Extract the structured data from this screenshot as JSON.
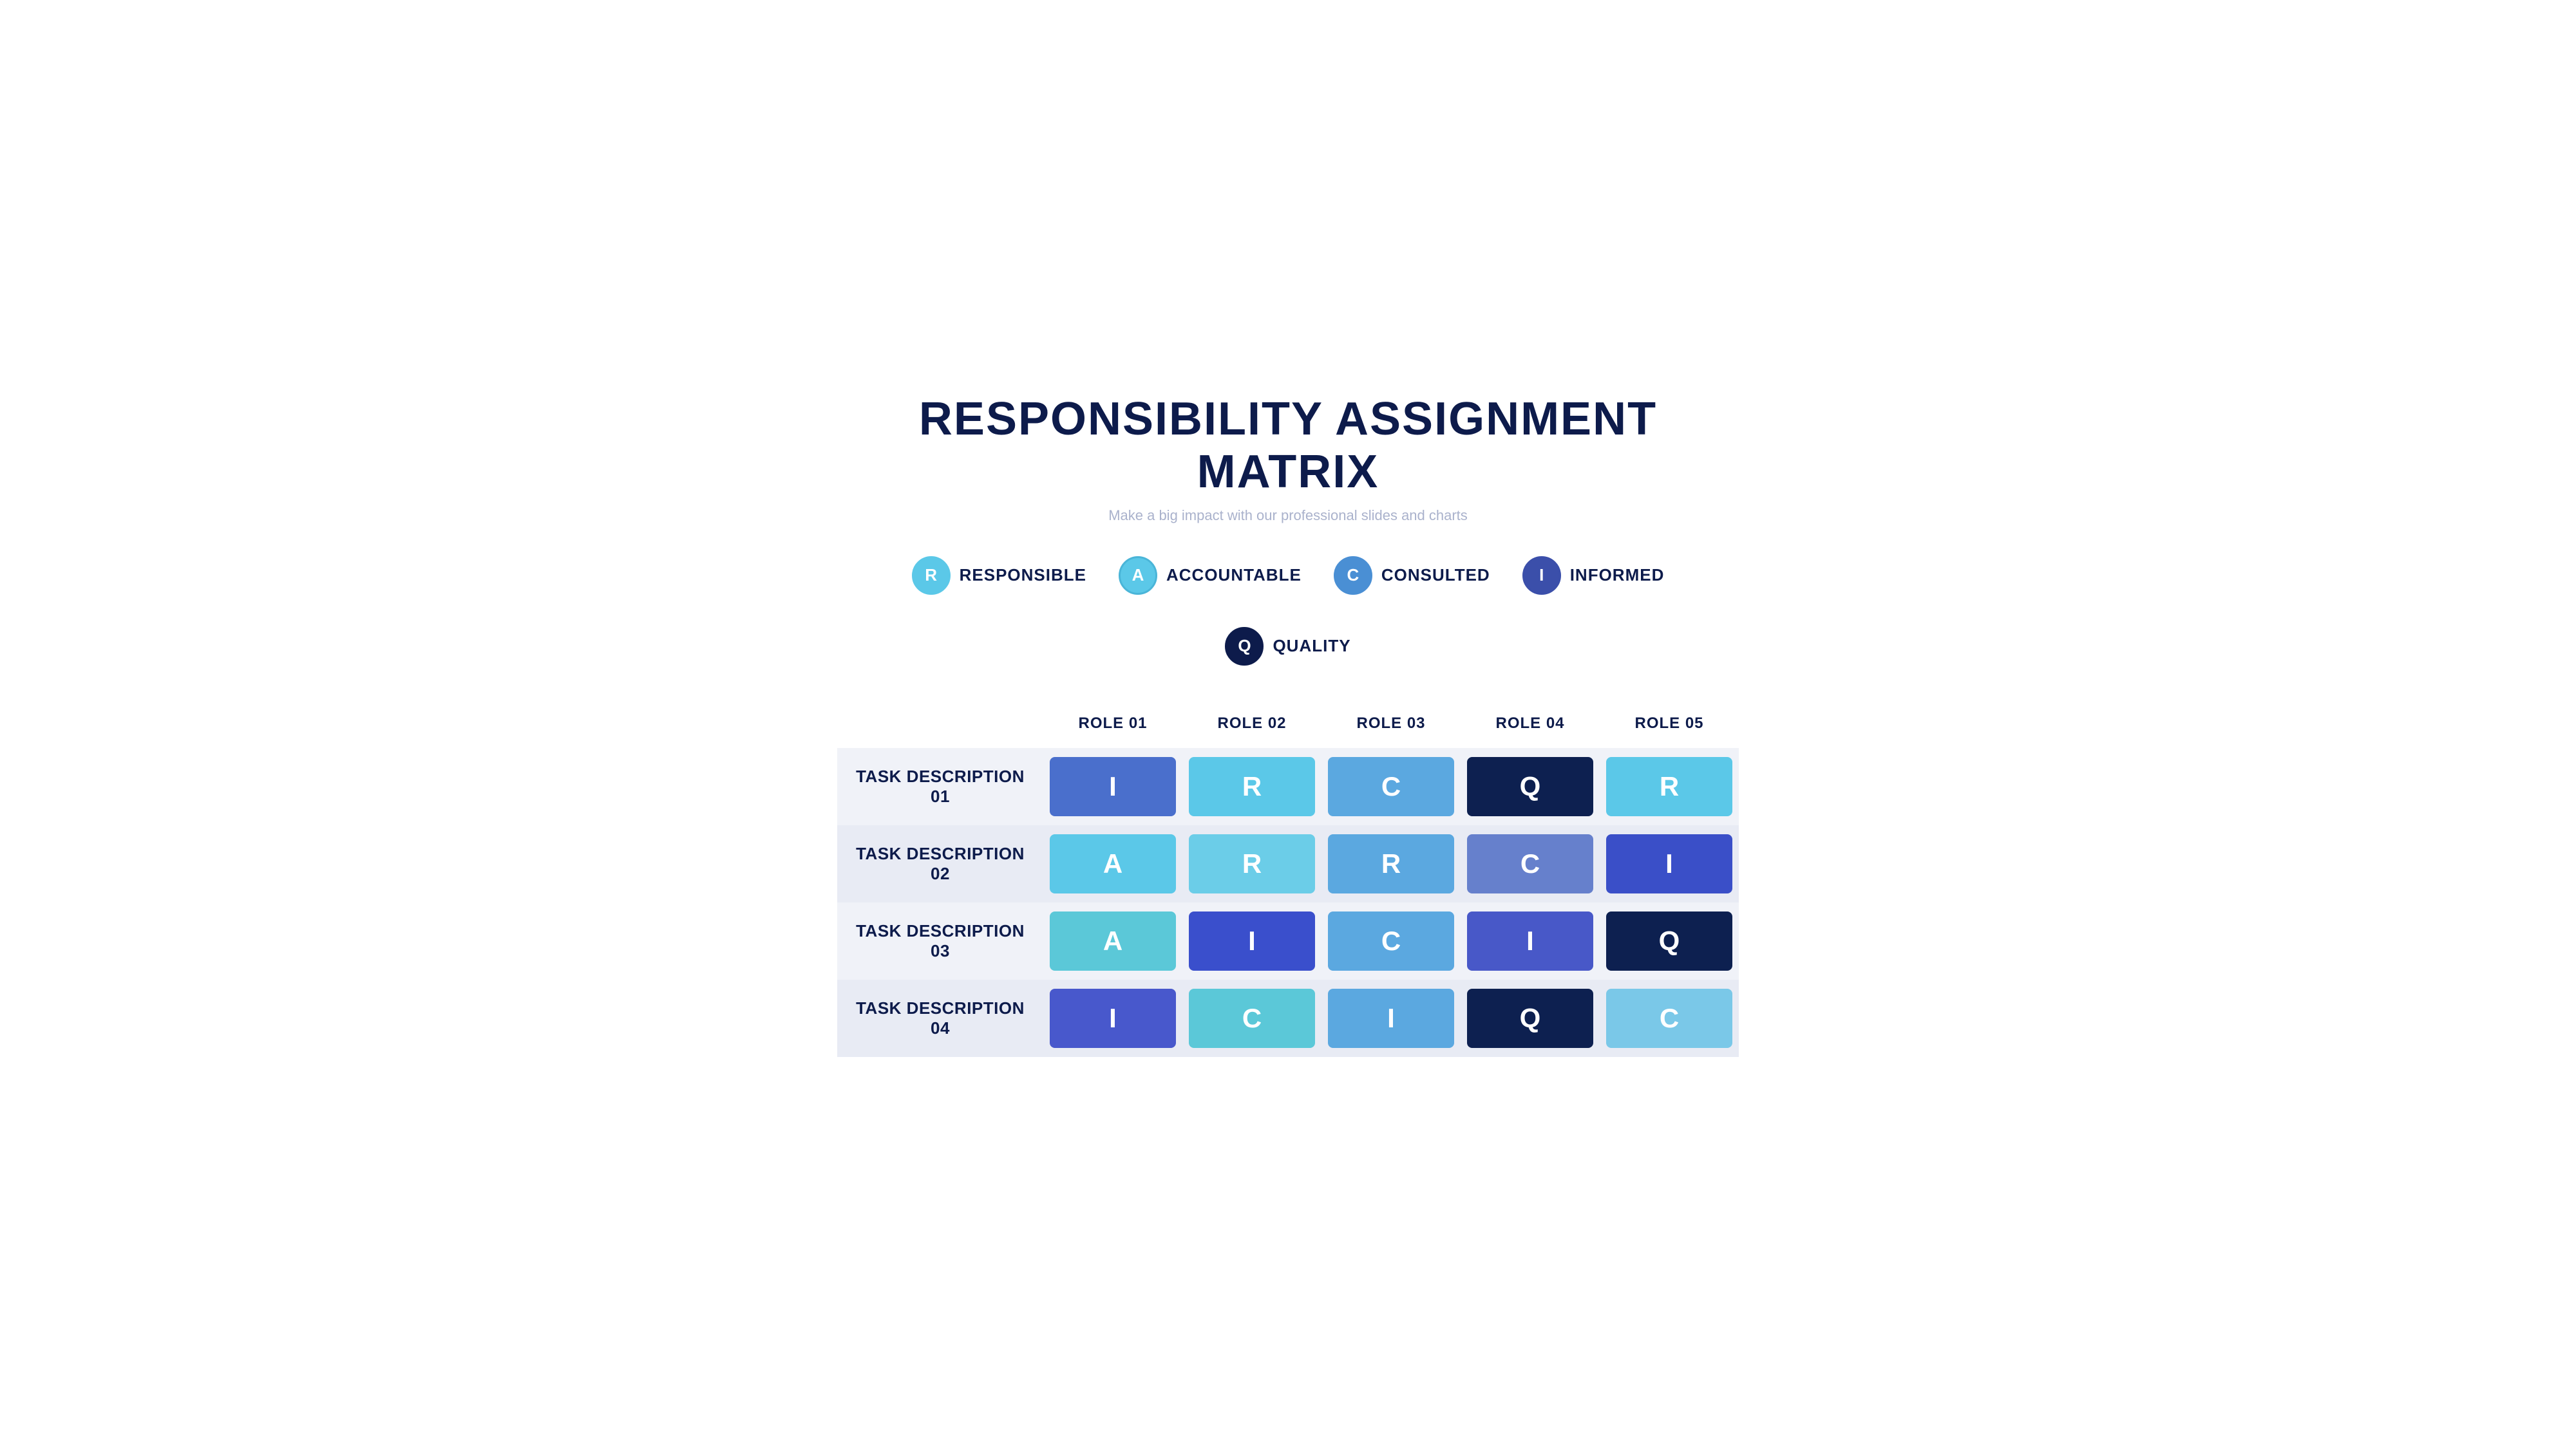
{
  "header": {
    "title": "RESPONSIBILITY ASSIGNMENT MATRIX",
    "subtitle": "Make a big impact with our professional slides and charts"
  },
  "legend": {
    "items": [
      {
        "id": "r",
        "letter": "R",
        "label": "RESPONSIBLE",
        "circle_class": "circle-r"
      },
      {
        "id": "a",
        "letter": "A",
        "label": "ACCOUNTABLE",
        "circle_class": "circle-a"
      },
      {
        "id": "c",
        "letter": "C",
        "label": "CONSULTED",
        "circle_class": "circle-c"
      },
      {
        "id": "i",
        "letter": "I",
        "label": "INFORMED",
        "circle_class": "circle-i"
      },
      {
        "id": "q",
        "letter": "Q",
        "label": "QUALITY",
        "circle_class": "circle-q"
      }
    ]
  },
  "matrix": {
    "columns": [
      "",
      "ROLE 01",
      "ROLE 02",
      "ROLE 03",
      "ROLE 04",
      "ROLE 05"
    ],
    "rows": [
      {
        "task": "TASK DESCRIPTION 01",
        "cells": [
          {
            "letter": "I",
            "badge_class": "badge-blue-medium"
          },
          {
            "letter": "R",
            "badge_class": "badge-cyan-light"
          },
          {
            "letter": "C",
            "badge_class": "badge-blue-light"
          },
          {
            "letter": "Q",
            "badge_class": "badge-dark-navy"
          },
          {
            "letter": "R",
            "badge_class": "badge-cyan-light2"
          }
        ]
      },
      {
        "task": "TASK DESCRIPTION 02",
        "cells": [
          {
            "letter": "A",
            "badge_class": "badge-cyan-medium"
          },
          {
            "letter": "R",
            "badge_class": "badge-cyan-med2"
          },
          {
            "letter": "R",
            "badge_class": "badge-blue-med"
          },
          {
            "letter": "C",
            "badge_class": "badge-blue-periwinkle"
          },
          {
            "letter": "I",
            "badge_class": "badge-indigo"
          }
        ]
      },
      {
        "task": "TASK DESCRIPTION 03",
        "cells": [
          {
            "letter": "A",
            "badge_class": "badge-teal"
          },
          {
            "letter": "I",
            "badge_class": "badge-indigo2"
          },
          {
            "letter": "C",
            "badge_class": "badge-blue-mid"
          },
          {
            "letter": "I",
            "badge_class": "badge-indigo3"
          },
          {
            "letter": "Q",
            "badge_class": "badge-dark-navy2"
          }
        ]
      },
      {
        "task": "TASK DESCRIPTION 04",
        "cells": [
          {
            "letter": "I",
            "badge_class": "badge-indigo4"
          },
          {
            "letter": "C",
            "badge_class": "badge-teal2"
          },
          {
            "letter": "I",
            "badge_class": "badge-mid-blue"
          },
          {
            "letter": "Q",
            "badge_class": "badge-dark-navy3"
          },
          {
            "letter": "C",
            "badge_class": "badge-sky"
          }
        ]
      }
    ]
  }
}
